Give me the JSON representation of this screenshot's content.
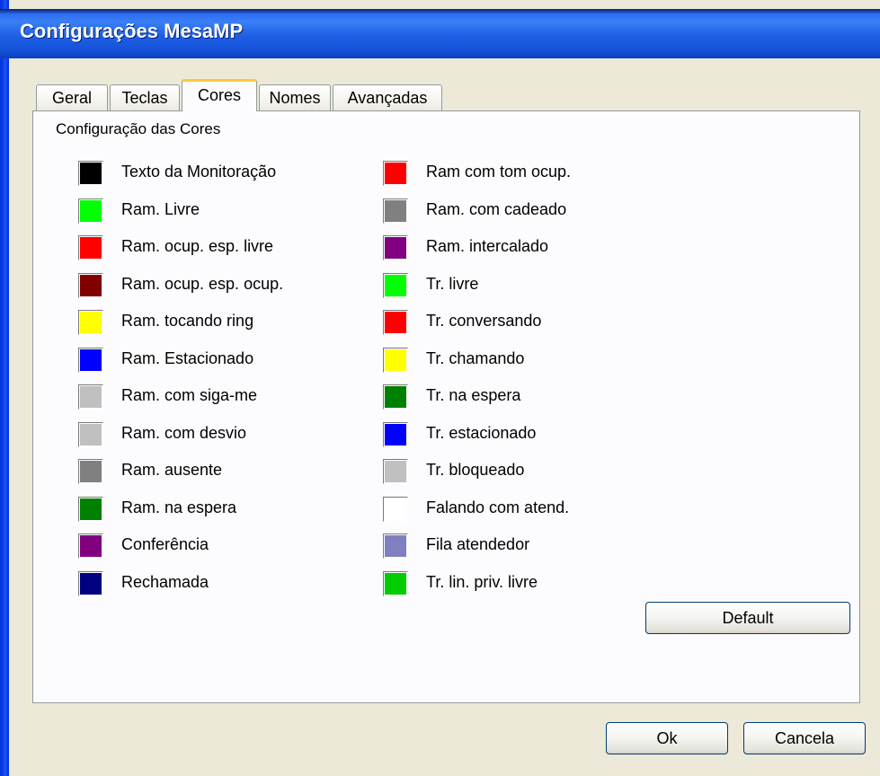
{
  "window": {
    "title": "Configurações MesaMP"
  },
  "tabs": [
    {
      "label": "Geral"
    },
    {
      "label": "Teclas"
    },
    {
      "label": "Cores"
    },
    {
      "label": "Nomes"
    },
    {
      "label": "Avançadas"
    }
  ],
  "active_tab": "Cores",
  "panel": {
    "group_title": "Configuração das Cores"
  },
  "left_colors": [
    {
      "label": "Texto da Monitoração",
      "color": "#000000"
    },
    {
      "label": "Ram. Livre",
      "color": "#00ff00"
    },
    {
      "label": "Ram. ocup. esp. livre",
      "color": "#ff0000"
    },
    {
      "label": "Ram. ocup. esp. ocup.",
      "color": "#800000"
    },
    {
      "label": "Ram. tocando ring",
      "color": "#ffff00"
    },
    {
      "label": "Ram. Estacionado",
      "color": "#0000ff"
    },
    {
      "label": "Ram. com siga-me",
      "color": "#c0c0c0"
    },
    {
      "label": "Ram. com desvio",
      "color": "#c0c0c0"
    },
    {
      "label": "Ram. ausente",
      "color": "#808080"
    },
    {
      "label": "Ram. na espera",
      "color": "#008000"
    },
    {
      "label": "Conferência",
      "color": "#800080"
    },
    {
      "label": "Rechamada",
      "color": "#000080"
    }
  ],
  "right_colors": [
    {
      "label": "Ram com tom ocup.",
      "color": "#ff0000"
    },
    {
      "label": "Ram. com cadeado",
      "color": "#808080"
    },
    {
      "label": "Ram. intercalado",
      "color": "#800080"
    },
    {
      "label": "Tr. livre",
      "color": "#00ff00"
    },
    {
      "label": "Tr. conversando",
      "color": "#ff0000"
    },
    {
      "label": "Tr. chamando",
      "color": "#ffff00"
    },
    {
      "label": "Tr. na espera",
      "color": "#008000"
    },
    {
      "label": "Tr. estacionado",
      "color": "#0000ff"
    },
    {
      "label": "Tr. bloqueado",
      "color": "#c0c0c0"
    },
    {
      "label": "Falando com atend.",
      "color": "#ffffff"
    },
    {
      "label": "Fila atendedor",
      "color": "#8080c0"
    },
    {
      "label": "Tr. lin. priv. livre",
      "color": "#00cc00"
    }
  ],
  "buttons": {
    "default_label": "Default",
    "ok_label": "Ok",
    "cancel_label": "Cancela"
  }
}
